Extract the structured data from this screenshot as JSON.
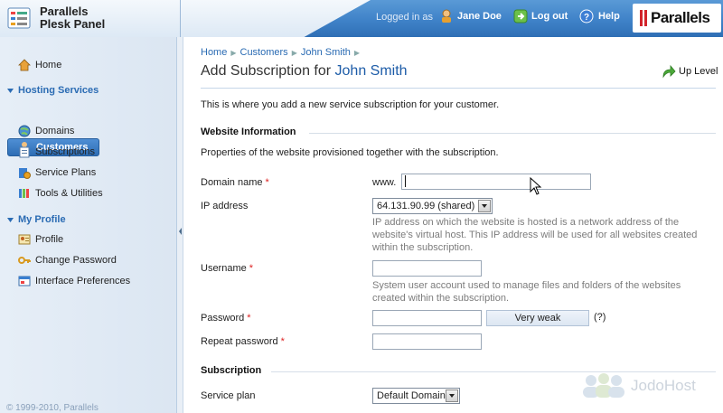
{
  "header": {
    "logo_line1": "Parallels",
    "logo_line2": "Plesk Panel",
    "logged_in_as": "Logged in as",
    "user_name": "Jane Doe",
    "logout_label": "Log out",
    "help_label": "Help",
    "brand": "Parallels"
  },
  "sidebar": {
    "home": "Home",
    "hosting_section": "Hosting Services",
    "hosting_items": [
      "Customers",
      "Domains",
      "Subscriptions",
      "Service Plans",
      "Tools & Utilities"
    ],
    "active_item": "Customers",
    "profile_section": "My Profile",
    "profile_items": [
      "Profile",
      "Change Password",
      "Interface Preferences"
    ],
    "copyright": "© 1999-2010, Parallels"
  },
  "main": {
    "breadcrumb": [
      "Home",
      "Customers",
      "John Smith"
    ],
    "title_prefix": "Add Subscription for",
    "title_customer": "John Smith",
    "up_level": "Up Level",
    "intro": "This is where you add a new service subscription for your customer.",
    "website_section": "Website Information",
    "website_desc": "Properties of the website provisioned together with the subscription.",
    "domain_label": "Domain name",
    "domain_prefix": "www.",
    "domain_value": "",
    "ip_label": "IP address",
    "ip_value": "64.131.90.99 (shared)",
    "ip_hint": "IP address on which the website is hosted is a network address of the website's virtual host. This IP address will be used for all websites created within the subscription.",
    "username_label": "Username",
    "username_value": "",
    "username_hint": "System user account used to manage files and folders of the websites created within the subscription.",
    "password_label": "Password",
    "password_value": "",
    "strength": "Very weak",
    "strength_help": "(?)",
    "repeat_label": "Repeat password",
    "repeat_value": "",
    "subscription_section": "Subscription",
    "plan_label": "Service plan",
    "plan_value": "Default Domain",
    "required_mark": "*"
  },
  "watermark": "JodoHost",
  "colors": {
    "accent": "#2a6bb3",
    "header_blue": "#3f82c8",
    "required": "#dd2222"
  }
}
